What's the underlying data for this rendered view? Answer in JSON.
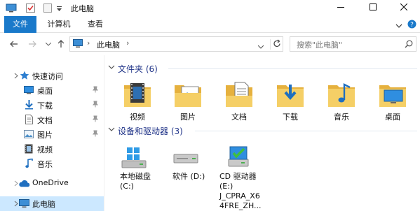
{
  "window": {
    "title": "此电脑",
    "quick_access_icons": [
      "computer-icon",
      "checkbox-icon",
      "blank-doc-icon",
      "dropdown-arrow-icon"
    ],
    "controls": [
      "minimize-icon",
      "maximize-icon",
      "close-icon"
    ]
  },
  "ribbon": {
    "tabs": [
      {
        "label": "文件",
        "active": true
      },
      {
        "label": "计算机",
        "active": false
      },
      {
        "label": "查看",
        "active": false
      }
    ],
    "expand_icon": "chevron-down-icon",
    "help_icon": "help-icon"
  },
  "navigation": {
    "back_icon": "back-arrow-icon",
    "forward_icon": "forward-arrow-icon",
    "recent_icon": "chevron-down-icon",
    "up_icon": "up-arrow-icon"
  },
  "address": {
    "path": "此电脑",
    "separator": "›",
    "refresh_icon": "refresh-icon"
  },
  "search": {
    "placeholder": "搜索\"此电脑\"",
    "icon": "search-icon"
  },
  "sidebar": {
    "items": [
      {
        "label": "快速访问",
        "icon": "star-icon",
        "pinned": false,
        "selected": false
      },
      {
        "label": "桌面",
        "icon": "desktop-icon",
        "pinned": true,
        "selected": false
      },
      {
        "label": "下载",
        "icon": "download-icon",
        "pinned": true,
        "selected": false
      },
      {
        "label": "文档",
        "icon": "document-icon",
        "pinned": true,
        "selected": false
      },
      {
        "label": "图片",
        "icon": "picture-icon",
        "pinned": true,
        "selected": false
      },
      {
        "label": "视频",
        "icon": "video-icon",
        "pinned": false,
        "selected": false
      },
      {
        "label": "音乐",
        "icon": "music-icon",
        "pinned": false,
        "selected": false
      },
      {
        "label": "OneDrive",
        "icon": "cloud-icon",
        "pinned": false,
        "selected": false
      },
      {
        "label": "此电脑",
        "icon": "computer-icon",
        "pinned": false,
        "selected": true
      }
    ]
  },
  "folders_section": {
    "title": "文件夹 (6)",
    "items": [
      {
        "label": "视频",
        "icon": "video-folder-icon"
      },
      {
        "label": "图片",
        "icon": "picture-folder-icon"
      },
      {
        "label": "文档",
        "icon": "document-folder-icon"
      },
      {
        "label": "下载",
        "icon": "download-folder-icon"
      },
      {
        "label": "音乐",
        "icon": "music-folder-icon"
      },
      {
        "label": "桌面",
        "icon": "desktop-folder-icon"
      }
    ]
  },
  "drives_section": {
    "title": "设备和驱动器 (3)",
    "items": [
      {
        "line1": "本地磁盘",
        "line2": "(C:)",
        "line3": "",
        "line4": "",
        "icon": "windows-drive-icon"
      },
      {
        "line1": "软件 (D:)",
        "line2": "",
        "line3": "",
        "line4": "",
        "icon": "hard-drive-icon"
      },
      {
        "line1": "CD 驱动器",
        "line2": "(E:)",
        "line3": "J_CPRA_X6",
        "line4": "4FRE_ZH...",
        "icon": "cd-drive-icon"
      }
    ]
  },
  "colors": {
    "accent": "#1979ca",
    "selection": "#cce8ff",
    "section_header": "#1e3287",
    "folder": "#f2c75a"
  }
}
